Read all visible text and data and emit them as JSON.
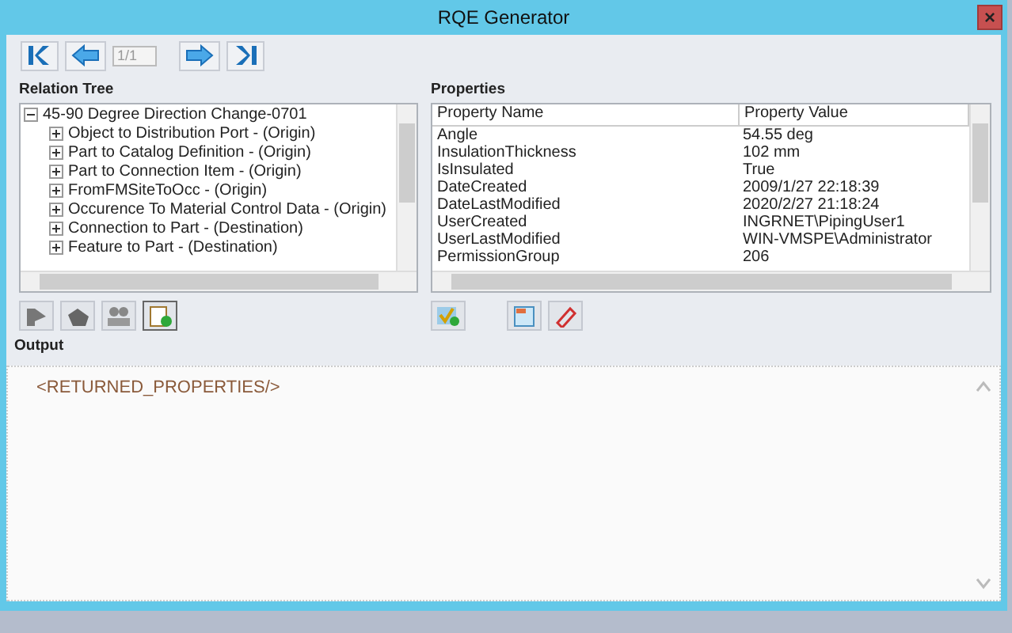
{
  "window": {
    "title": "RQE Generator",
    "close": "×"
  },
  "navigation": {
    "page_field": {
      "value": "1/1",
      "disabled": true
    }
  },
  "relation_tree": {
    "label": "Relation Tree",
    "items": [
      {
        "label": "45-90 Degree Direction Change-0701",
        "expanded": true,
        "children": [
          {
            "label": "Object to Distribution Port - (Origin)",
            "expanded": false
          },
          {
            "label": "Part to Catalog Definition - (Origin)",
            "expanded": false
          },
          {
            "label": "Part to Connection Item - (Origin)",
            "expanded": false
          },
          {
            "label": "FromFMSiteToOcc - (Origin)",
            "expanded": false
          },
          {
            "label": "Occurence To Material Control Data - (Origin)",
            "expanded": false
          },
          {
            "label": "Connection to Part - (Destination)",
            "expanded": false
          },
          {
            "label": "Feature to Part - (Destination)",
            "expanded": false
          }
        ]
      }
    ]
  },
  "properties": {
    "label": "Properties",
    "columns": [
      "Property Name",
      "Property Value"
    ],
    "rows": [
      [
        "Angle",
        "54.55 deg"
      ],
      [
        "InsulationThickness",
        "102 mm"
      ],
      [
        "IsInsulated",
        "True"
      ],
      [
        "DateCreated",
        "2009/1/27 22:18:39"
      ],
      [
        "DateLastModified",
        "2020/2/27 21:18:24"
      ],
      [
        "UserCreated",
        "INGRNET\\PipingUser1"
      ],
      [
        "UserLastModified",
        "WIN-VMSPE\\Administrator"
      ],
      [
        "PermissionGroup",
        "206"
      ]
    ]
  },
  "output": {
    "label": "Output",
    "text": "<RETURNED_PROPERTIES/>"
  }
}
